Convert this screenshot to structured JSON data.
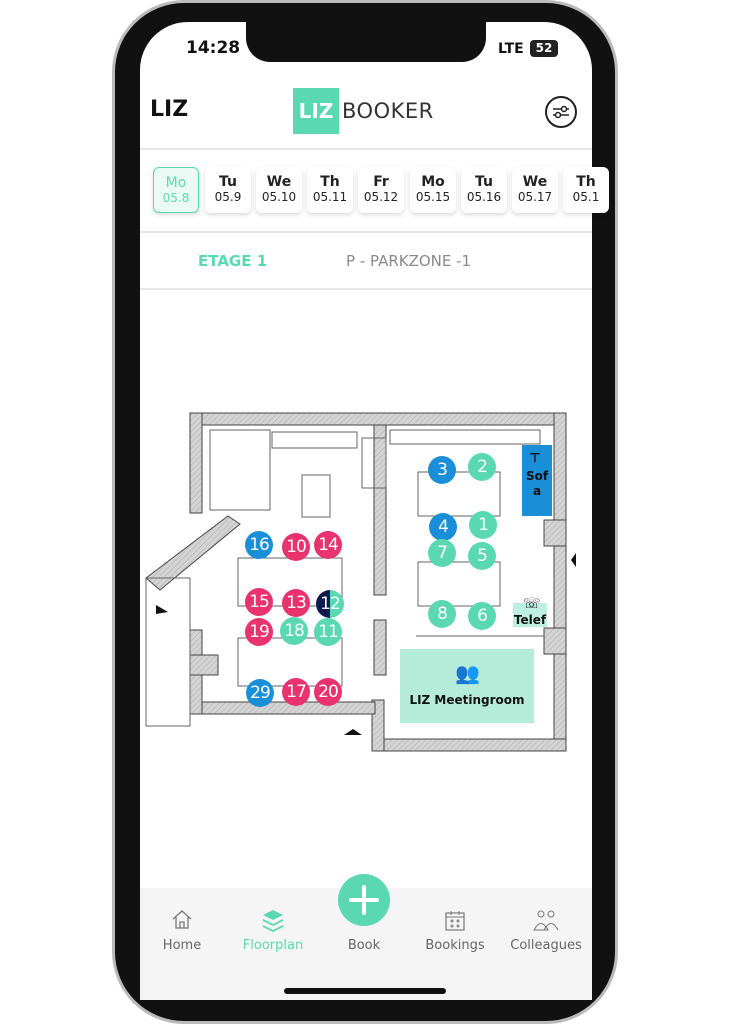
{
  "status": {
    "time": "14:28",
    "network": "LTE",
    "battery": "52"
  },
  "header": {
    "company": "LIZ",
    "logo_box": "LIZ",
    "logo_text": "BOOKER",
    "filter_icon": "sliders-icon"
  },
  "days": [
    {
      "day": "Mo",
      "date": "05.8",
      "selected": true
    },
    {
      "day": "Tu",
      "date": "05.9"
    },
    {
      "day": "We",
      "date": "05.10"
    },
    {
      "day": "Th",
      "date": "05.11"
    },
    {
      "day": "Fr",
      "date": "05.12"
    },
    {
      "day": "Mo",
      "date": "05.15"
    },
    {
      "day": "Tu",
      "date": "05.16"
    },
    {
      "day": "We",
      "date": "05.17"
    },
    {
      "day": "Th",
      "date": "05.1"
    }
  ],
  "floors": [
    {
      "label": "ETAGE 1",
      "active": true
    },
    {
      "label": "P - PARKZONE -1",
      "active": false
    }
  ],
  "colors": {
    "accent": "#5ad8b0",
    "booked": "#e8336f",
    "mine": "#1a8fd8",
    "free": "#5ad8b0",
    "partial": "#0d1b4f"
  },
  "seats": [
    {
      "label": "3",
      "status": "mine"
    },
    {
      "label": "2",
      "status": "free"
    },
    {
      "label": "4",
      "status": "mine"
    },
    {
      "label": "1",
      "status": "free"
    },
    {
      "label": "7",
      "status": "free"
    },
    {
      "label": "5",
      "status": "free"
    },
    {
      "label": "8",
      "status": "free"
    },
    {
      "label": "6",
      "status": "free"
    },
    {
      "label": "16",
      "status": "mine"
    },
    {
      "label": "10",
      "status": "booked"
    },
    {
      "label": "14",
      "status": "booked"
    },
    {
      "label": "15",
      "status": "booked"
    },
    {
      "label": "13",
      "status": "booked"
    },
    {
      "label": "12",
      "status": "partial"
    },
    {
      "label": "19",
      "status": "booked"
    },
    {
      "label": "18",
      "status": "free"
    },
    {
      "label": "11",
      "status": "free"
    },
    {
      "label": "29",
      "status": "mine"
    },
    {
      "label": "17",
      "status": "booked"
    },
    {
      "label": "20",
      "status": "booked"
    }
  ],
  "rooms": {
    "sofa": "Sofa",
    "phone": "Telef",
    "meeting": "LIZ Meetingroom"
  },
  "nav": [
    {
      "label": "Home",
      "icon": "home-icon"
    },
    {
      "label": "Floorplan",
      "icon": "layers-icon",
      "active": true
    },
    {
      "label": "Book",
      "icon": "plus-icon"
    },
    {
      "label": "Bookings",
      "icon": "calendar-icon"
    },
    {
      "label": "Colleagues",
      "icon": "users-icon"
    }
  ]
}
